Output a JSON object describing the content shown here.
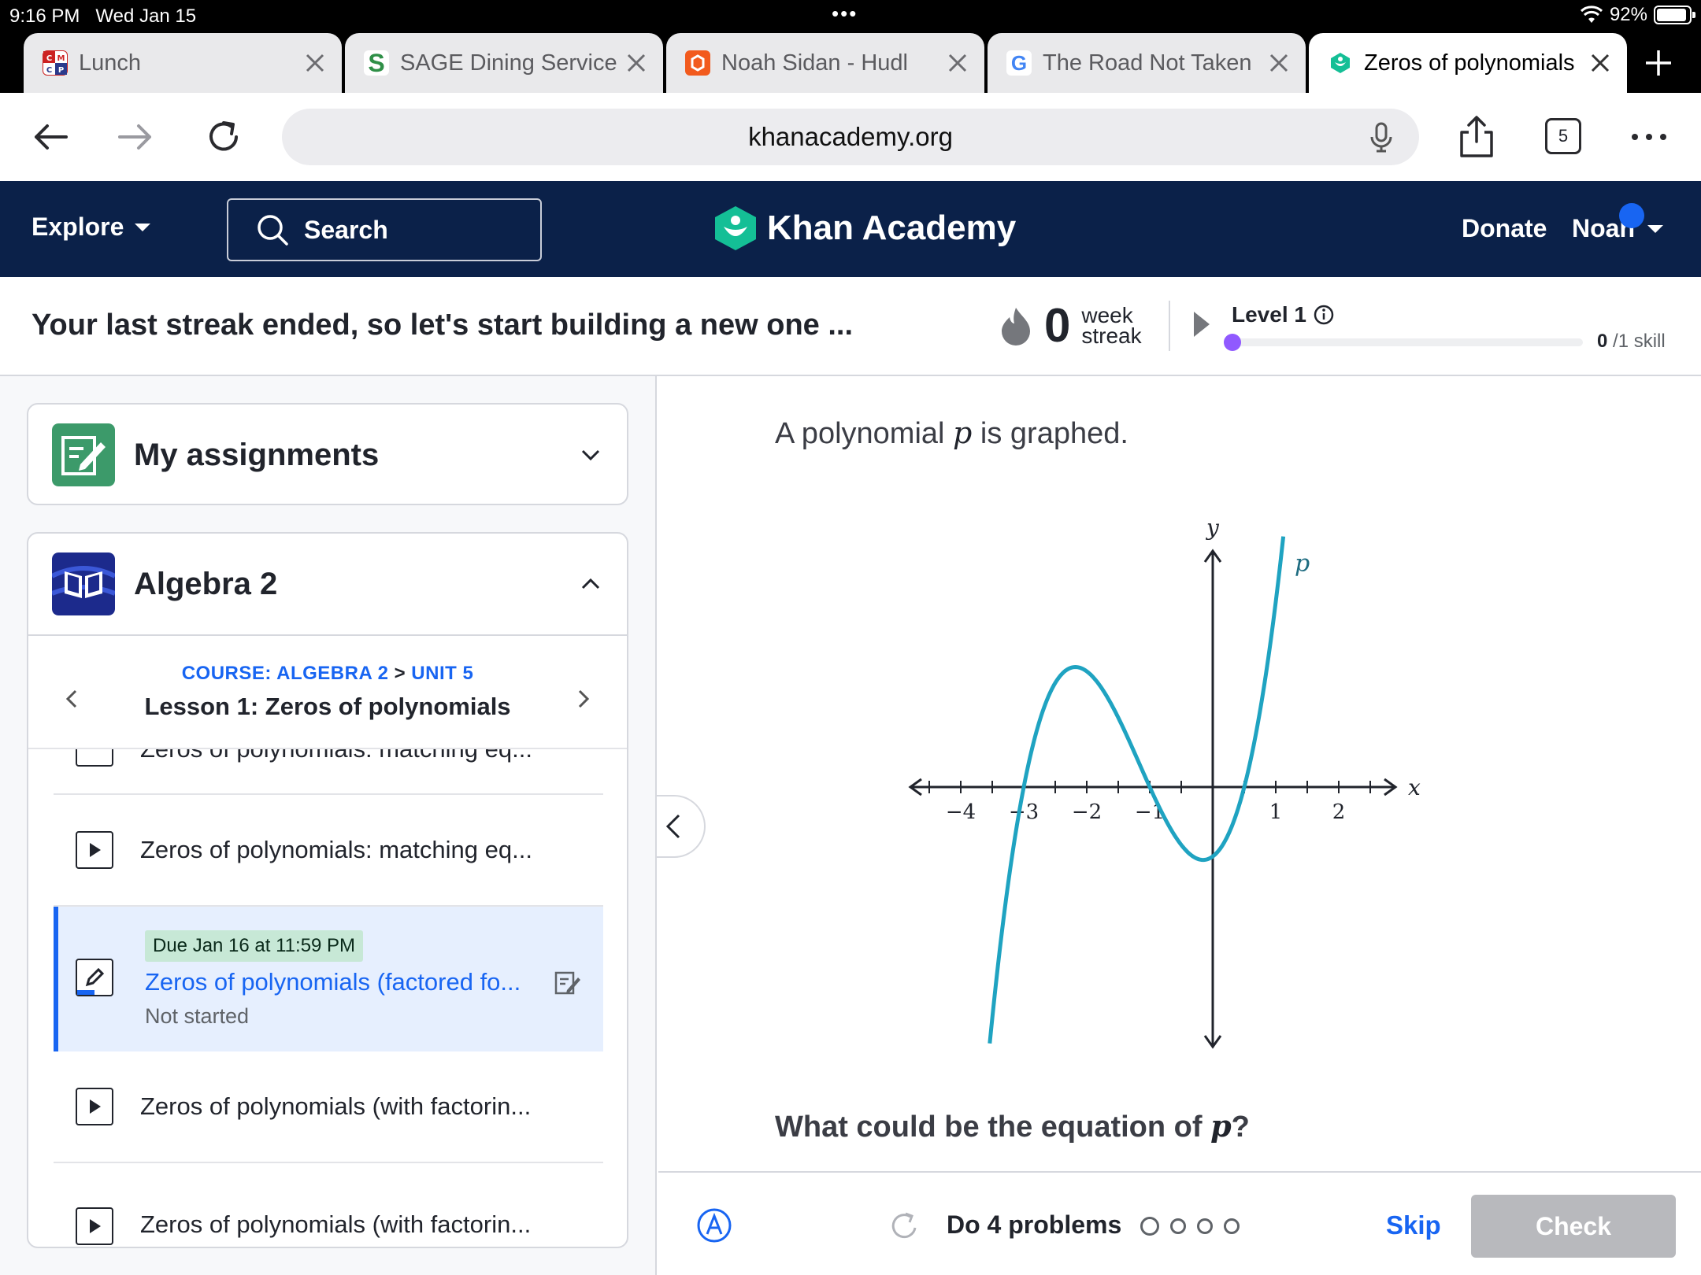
{
  "status": {
    "time": "9:16 PM",
    "date": "Wed Jan 15",
    "battery": "92%",
    "battery_level": 0.92
  },
  "tabs": [
    {
      "title": "Lunch",
      "favicon": "cmcp-logo",
      "favicon_text": "CM CP",
      "active": false
    },
    {
      "title": "SAGE Dining Service",
      "favicon": "sage-logo",
      "favicon_text": "S",
      "active": false
    },
    {
      "title": "Noah Sidan - Hudl",
      "favicon": "hudl-logo",
      "favicon_text": "",
      "active": false
    },
    {
      "title": "The Road Not Taken",
      "favicon": "google-logo",
      "favicon_text": "G",
      "active": false
    },
    {
      "title": "Zeros of polynomials",
      "favicon": "khan-logo",
      "favicon_text": "",
      "active": true
    }
  ],
  "address_bar": {
    "url": "khanacademy.org",
    "tab_count": "5"
  },
  "header": {
    "explore": "Explore",
    "search_placeholder": "Search",
    "brand": "Khan Academy",
    "donate": "Donate",
    "user": "Noah"
  },
  "streak": {
    "message": "Your last streak ended, so let's start building a new one ...",
    "count": "0",
    "unit_line1": "week",
    "unit_line2": "streak",
    "level": "Level 1",
    "skills_done": "0",
    "skills_total": "/1 skill",
    "progress": 0
  },
  "sidebar": {
    "assignments_title": "My assignments",
    "course_title": "Algebra 2",
    "breadcrumb_course": "COURSE: ALGEBRA 2",
    "breadcrumb_sep": ">",
    "breadcrumb_unit": "UNIT 5",
    "lesson_title": "Lesson 1: Zeros of polynomials",
    "items": [
      {
        "label": "Zeros of polynomials: matching eq...",
        "type": "exercise"
      },
      {
        "label": "Zeros of polynomials: matching eq...",
        "type": "video"
      },
      {
        "label": "Zeros of polynomials (factored fo...",
        "type": "assignment",
        "due": "Due Jan 16 at 11:59 PM",
        "status": "Not started"
      },
      {
        "label": "Zeros of polynomials (with factorin...",
        "type": "video"
      },
      {
        "label": "Zeros of polynomials (with factorin...",
        "type": "video"
      }
    ]
  },
  "exercise": {
    "prompt_before": "A polynomial",
    "prompt_var": "p",
    "prompt_after": "is graphed.",
    "question_before": "What could be the equation of",
    "question_var": "p",
    "question_after": "?",
    "do_problems": "Do 4 problems",
    "problem_count": 4,
    "skip": "Skip",
    "check": "Check"
  },
  "graph": {
    "x_label": "x",
    "y_label": "y",
    "curve_label": "p",
    "curve_color": "#1fa3c1",
    "x_ticks": [
      "−4",
      "−3",
      "−2",
      "−1",
      "1",
      "2"
    ],
    "x_tick_values": [
      -4,
      -3,
      -2,
      -1,
      1,
      2
    ],
    "zeros": [
      -3,
      -1,
      0.5
    ],
    "x_range": [
      -5,
      3
    ],
    "y_range": [
      -4,
      4
    ]
  }
}
